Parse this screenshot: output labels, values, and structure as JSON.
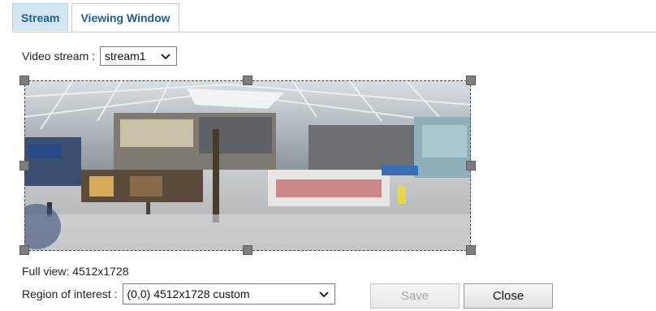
{
  "tabs": [
    {
      "label": "Stream"
    },
    {
      "label": "Viewing Window"
    }
  ],
  "video_stream": {
    "label": "Video stream :",
    "value": "stream1"
  },
  "full_view": {
    "text": "Full view: 4512x1728"
  },
  "region_of_interest": {
    "label": "Region of interest :",
    "value": "(0,0) 4512x1728 custom"
  },
  "buttons": {
    "save_label": "Save",
    "close_label": "Close"
  },
  "icons": {
    "dropdown": "chevron-down-icon",
    "handle": "resize-handle"
  },
  "colors": {
    "tab_active_bg": "#d5e6f3",
    "tab_text": "#1f5d96",
    "handle": "#7d7d7d"
  }
}
